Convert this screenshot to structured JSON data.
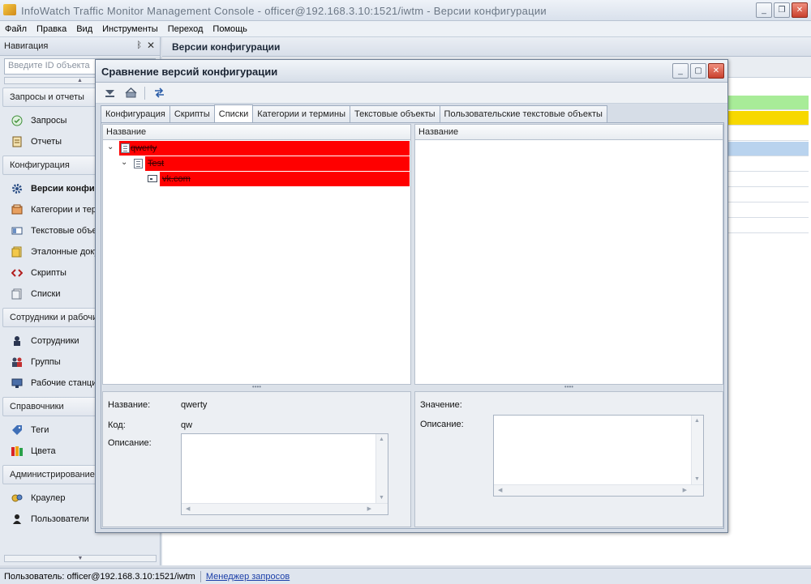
{
  "window": {
    "title": "InfoWatch Traffic Monitor Management Console - officer@192.168.3.10:1521/iwtm - Версии конфигурации",
    "minimize_glyph": "_",
    "restore_glyph": "❐",
    "close_glyph": "✕"
  },
  "menu": [
    "Файл",
    "Правка",
    "Вид",
    "Инструменты",
    "Переход",
    "Помощь"
  ],
  "nav": {
    "header": "Навигация",
    "pin_glyph": "ᛒ",
    "close_glyph": "✕",
    "search_placeholder": "Введите ID объекта",
    "groups": [
      {
        "label": "Запросы и отчеты",
        "items": [
          {
            "label": "Запросы",
            "icon": "query-icon"
          },
          {
            "label": "Отчеты",
            "icon": "report-icon"
          }
        ]
      },
      {
        "label": "Конфигурация",
        "items": [
          {
            "label": "Версии конфигурации",
            "icon": "gear-icon",
            "selected": true
          },
          {
            "label": "Категории и термины",
            "icon": "category-icon"
          },
          {
            "label": "Текстовые объекты",
            "icon": "text-object-icon"
          },
          {
            "label": "Эталонные документы",
            "icon": "reference-doc-icon"
          },
          {
            "label": "Скрипты",
            "icon": "script-icon"
          },
          {
            "label": "Списки",
            "icon": "list-icon"
          }
        ]
      },
      {
        "label": "Сотрудники и рабочие станции",
        "items": [
          {
            "label": "Сотрудники",
            "icon": "employee-icon"
          },
          {
            "label": "Группы",
            "icon": "group-icon"
          },
          {
            "label": "Рабочие станции",
            "icon": "workstation-icon"
          }
        ]
      },
      {
        "label": "Справочники",
        "items": [
          {
            "label": "Теги",
            "icon": "tag-icon"
          },
          {
            "label": "Цвета",
            "icon": "colors-icon"
          }
        ]
      },
      {
        "label": "Администрирование",
        "items": [
          {
            "label": "Краулер",
            "icon": "crawler-icon"
          },
          {
            "label": "Пользователи",
            "icon": "user-icon"
          }
        ]
      }
    ]
  },
  "document": {
    "title": "Версии конфигурации",
    "row_colors": [
      "#a8ec98",
      "#f7d800",
      "#ffffff",
      "#b9d3ee"
    ]
  },
  "status": {
    "user": "Пользователь: officer@192.168.3.10:1521/iwtm",
    "request_manager": "Менеджер запросов"
  },
  "dialog": {
    "title": "Сравнение версий конфигурации",
    "tabs": [
      {
        "label": "Конфигурация",
        "active": false
      },
      {
        "label": "Скрипты",
        "active": false
      },
      {
        "label": "Списки",
        "active": true
      },
      {
        "label": "Категории и термины",
        "active": false
      },
      {
        "label": "Текстовые объекты",
        "active": false
      },
      {
        "label": "Пользовательские текстовые объекты",
        "active": false
      }
    ],
    "left": {
      "column_header": "Название",
      "tree": [
        {
          "label": "qwerty",
          "level": 0,
          "status_color": "#ff0000"
        },
        {
          "label": "Test",
          "level": 1,
          "status_color": "#ff0000"
        },
        {
          "label": "vk.com",
          "level": 2,
          "status_color": "#ff0000"
        }
      ],
      "details": {
        "name_label": "Название:",
        "name_value": "qwerty",
        "code_label": "Код:",
        "code_value": "qw",
        "description_label": "Описание:",
        "description_value": ""
      }
    },
    "right": {
      "column_header": "Название",
      "details": {
        "value_label": "Значение:",
        "description_label": "Описание:",
        "description_value": ""
      }
    }
  }
}
